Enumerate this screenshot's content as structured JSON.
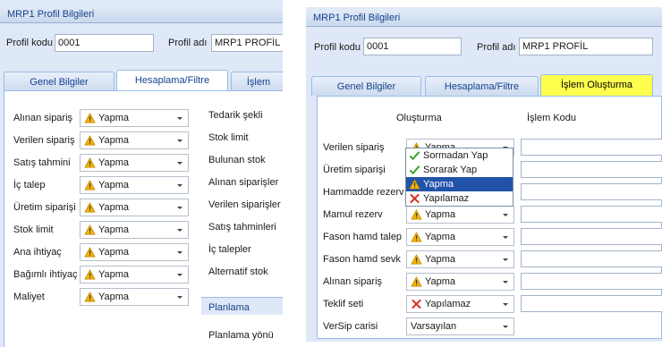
{
  "left": {
    "title": "MRP1 Profil Bilgileri",
    "profil_kodu_label": "Profil kodu",
    "profil_kodu": "0001",
    "profil_adi_label": "Profil adı",
    "profil_adi": "MRP1 PROFİL",
    "tabs": [
      {
        "label": "Genel Bilgiler"
      },
      {
        "label": "Hesaplama/Filtre"
      },
      {
        "label": "İşlem"
      }
    ],
    "rows": [
      {
        "label": "Alınan sipariş",
        "value": "Yapma",
        "icon": "warning-icon"
      },
      {
        "label": "Verilen sipariş",
        "value": "Yapma",
        "icon": "warning-icon"
      },
      {
        "label": "Satış tahmini",
        "value": "Yapma",
        "icon": "warning-icon"
      },
      {
        "label": "İç talep",
        "value": "Yapma",
        "icon": "warning-icon"
      },
      {
        "label": "Üretim siparişi",
        "value": "Yapma",
        "icon": "warning-icon"
      },
      {
        "label": "Stok limit",
        "value": "Yapma",
        "icon": "warning-icon"
      },
      {
        "label": "Ana ihtiyaç",
        "value": "Yapma",
        "icon": "warning-icon"
      },
      {
        "label": "Bağımlı ihtiyaç",
        "value": "Yapma",
        "icon": "warning-icon"
      },
      {
        "label": "Maliyet",
        "value": "Yapma",
        "icon": "warning-icon"
      }
    ],
    "right_labels": [
      "Tedarik şekli",
      "Stok limit",
      "Bulunan stok",
      "Alınan siparişler",
      "Verilen siparişler",
      "Satış tahminleri",
      "İç talepler",
      "Alternatif stok"
    ],
    "planlama_header": "Planlama",
    "planlama_yonu": "Planlama yönü"
  },
  "right": {
    "title": "MRP1 Profil Bilgileri",
    "profil_kodu_label": "Profil kodu",
    "profil_kodu": "0001",
    "profil_adi_label": "Profil adı",
    "profil_adi": "MRP1 PROFİL",
    "tabs": [
      {
        "label": "Genel Bilgiler"
      },
      {
        "label": "Hesaplama/Filtre"
      },
      {
        "label": "İşlem Oluşturma"
      }
    ],
    "col_olusturma": "Oluşturma",
    "col_islem_kodu": "İşlem Kodu",
    "rows": [
      {
        "label": "Verilen sipariş",
        "value": "Yapma",
        "icon": "warning-icon"
      },
      {
        "label": "Üretim siparişi",
        "value": "",
        "icon": ""
      },
      {
        "label": "Hammadde rezerv",
        "value": "",
        "icon": ""
      },
      {
        "label": "Mamul rezerv",
        "value": "Yapma",
        "icon": "warning-icon"
      },
      {
        "label": "Fason hamd talep",
        "value": "Yapma",
        "icon": "warning-icon"
      },
      {
        "label": "Fason hamd sevk",
        "value": "Yapma",
        "icon": "warning-icon"
      },
      {
        "label": "Alınan sipariş",
        "value": "Yapma",
        "icon": "warning-icon"
      },
      {
        "label": "Teklif seti",
        "value": "Yapılamaz",
        "icon": "cross-icon"
      },
      {
        "label": "VerSip carisi",
        "value": "Varsayılan",
        "icon": ""
      }
    ],
    "dropdown": [
      {
        "label": "Sormadan Yap",
        "icon": "check-icon"
      },
      {
        "label": "Sorarak Yap",
        "icon": "check-icon"
      },
      {
        "label": "Yapma",
        "icon": "warning-icon"
      },
      {
        "label": "Yapılamaz",
        "icon": "cross-icon"
      }
    ]
  },
  "colors": {
    "panel": "#dfe8f6",
    "tab_highlight": "#ffff4d",
    "selection": "#2153a8",
    "title_text": "#15428b"
  }
}
